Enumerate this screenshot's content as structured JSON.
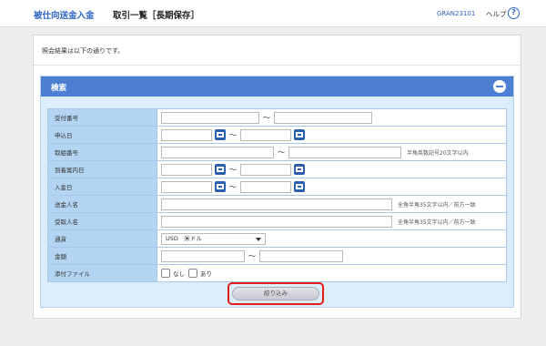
{
  "header": {
    "app_title": "被仕向送金入金",
    "page_title": "取引一覧［長期保存］",
    "screen_id": "GRAN23101",
    "help_label": "ヘルプ",
    "help_icon": "?"
  },
  "message": "照会結果は以下の通りです。",
  "search": {
    "title": "検索",
    "rows": [
      {
        "label": "受付番号",
        "type": "range"
      },
      {
        "label": "申込日",
        "type": "date-range"
      },
      {
        "label": "取組番号",
        "type": "range-note",
        "note": "半角英数記号20文字以内"
      },
      {
        "label": "到着案内日",
        "type": "date-range"
      },
      {
        "label": "入金日",
        "type": "date-range"
      },
      {
        "label": "送金人名",
        "type": "text-note",
        "note": "全角半角35文字以内／前方一致"
      },
      {
        "label": "受取人名",
        "type": "text-note",
        "note": "全角半角35文字以内／前方一致"
      },
      {
        "label": "通貨",
        "type": "select",
        "selected": "USD　米ドル"
      },
      {
        "label": "金額",
        "type": "range"
      },
      {
        "label": "添付ファイル",
        "type": "checkbox",
        "options": [
          "なし",
          "あり"
        ]
      }
    ],
    "tilde": "～",
    "filter_button": "絞り込み"
  }
}
